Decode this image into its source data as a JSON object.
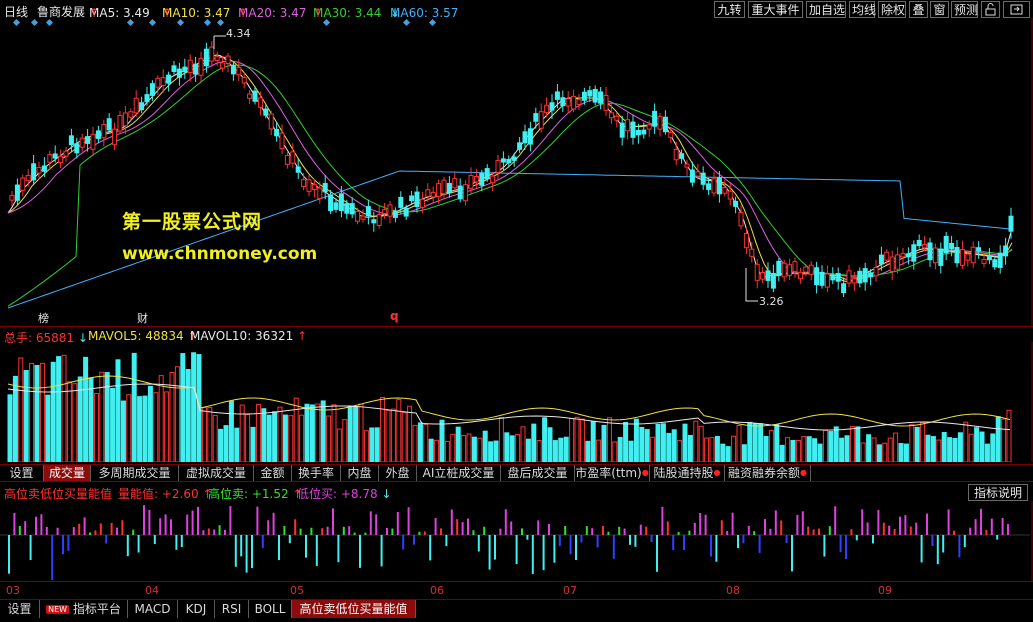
{
  "header": {
    "period": "日线",
    "stock_name": "鲁商发展",
    "ma": [
      {
        "label": "MA5: 3.49",
        "arrow": "↑",
        "color": "#e8e8e8"
      },
      {
        "label": "MA10: 3.47",
        "arrow": "↑",
        "color": "#f0e040"
      },
      {
        "label": "MA20: 3.47",
        "arrow": "↑",
        "color": "#e060e0"
      },
      {
        "label": "MA30: 3.44",
        "arrow": "↑",
        "color": "#30d030"
      },
      {
        "label": "MA60: 3.57",
        "arrow": "↓",
        "color": "#40b0ff"
      }
    ],
    "buttons": [
      "九转",
      "重大事件",
      "加自选",
      "均线",
      "除权",
      "叠",
      "窗",
      "预测"
    ],
    "lock_icon": "lock-icon",
    "fullscreen_icon": "fullscreen-icon"
  },
  "price_chart": {
    "high_label": "4.34",
    "low_label": "3.26",
    "event_tags": [
      "榜",
      "财",
      "q"
    ],
    "watermark_title": "第一股票公式网",
    "watermark_url": "www.chnmoney.com"
  },
  "volume_chart": {
    "total_label": "总手: ",
    "total_value": "65881",
    "total_arrow": "↓",
    "mavol5": "MAVOL5: 48834",
    "mavol5_arrow": "↑",
    "mavol10": "MAVOL10: 36321",
    "mavol10_arrow": "↑"
  },
  "volume_tabs": [
    "设置",
    "成交量",
    "多周期成交量",
    "虚拟成交量",
    "金额",
    "换手率",
    "内盘",
    "外盘",
    "AI立桩成交量",
    "盘后成交量",
    "市盈率(ttm)",
    "陆股通持股",
    "融资融券余额"
  ],
  "indicator": {
    "name": "高位卖低位买量能值",
    "value1": "量能值: +2.60",
    "value1_arrow": "↑",
    "value2": "高位卖: +1.52",
    "value2_arrow": "↑",
    "value3": "低位买: +8.78",
    "value3_arrow": "↓",
    "help_button": "指标说明"
  },
  "months": [
    "03",
    "04",
    "05",
    "06",
    "07",
    "08",
    "09"
  ],
  "bottom_tabs": {
    "settings": "设置",
    "new_badge": "NEW",
    "items": [
      "指标平台",
      "MACD",
      "KDJ",
      "RSI",
      "BOLL",
      "高位卖低位买量能值"
    ]
  },
  "colors": {
    "up": "#ff3030",
    "down": "#40f0f0",
    "accent": "#8c0c0c"
  }
}
